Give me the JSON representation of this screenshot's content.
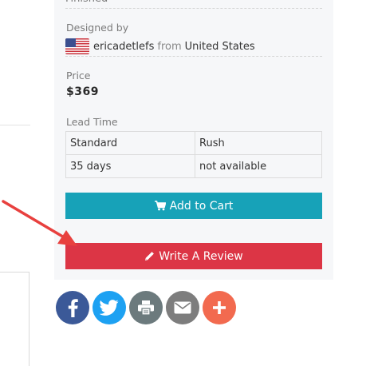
{
  "top_field": {
    "value": "Finished"
  },
  "designed_by": {
    "label": "Designed by",
    "flag_icon": "us-flag-icon",
    "designer": "ericadetlefs",
    "from_word": "from",
    "country": "United States"
  },
  "price": {
    "label": "Price",
    "value": "$369"
  },
  "lead_time": {
    "label": "Lead Time",
    "rows": [
      [
        "Standard",
        "Rush"
      ],
      [
        "35 days",
        "not available"
      ]
    ]
  },
  "buttons": {
    "add_to_cart": {
      "label": "Add to Cart",
      "icon": "cart-icon",
      "color": "#17a2b8"
    },
    "write_review": {
      "label": "Write A Review",
      "icon": "pencil-icon",
      "color": "#dc3545"
    }
  },
  "annotation": {
    "arrow_color": "#e8403e"
  },
  "share": [
    {
      "name": "facebook-share-icon",
      "color": "#3b5998"
    },
    {
      "name": "twitter-share-icon",
      "color": "#1da1f2"
    },
    {
      "name": "print-share-icon",
      "color": "#6c7a7d"
    },
    {
      "name": "email-share-icon",
      "color": "#7d7d7d"
    },
    {
      "name": "more-share-icon",
      "color": "#f26a4f"
    }
  ]
}
